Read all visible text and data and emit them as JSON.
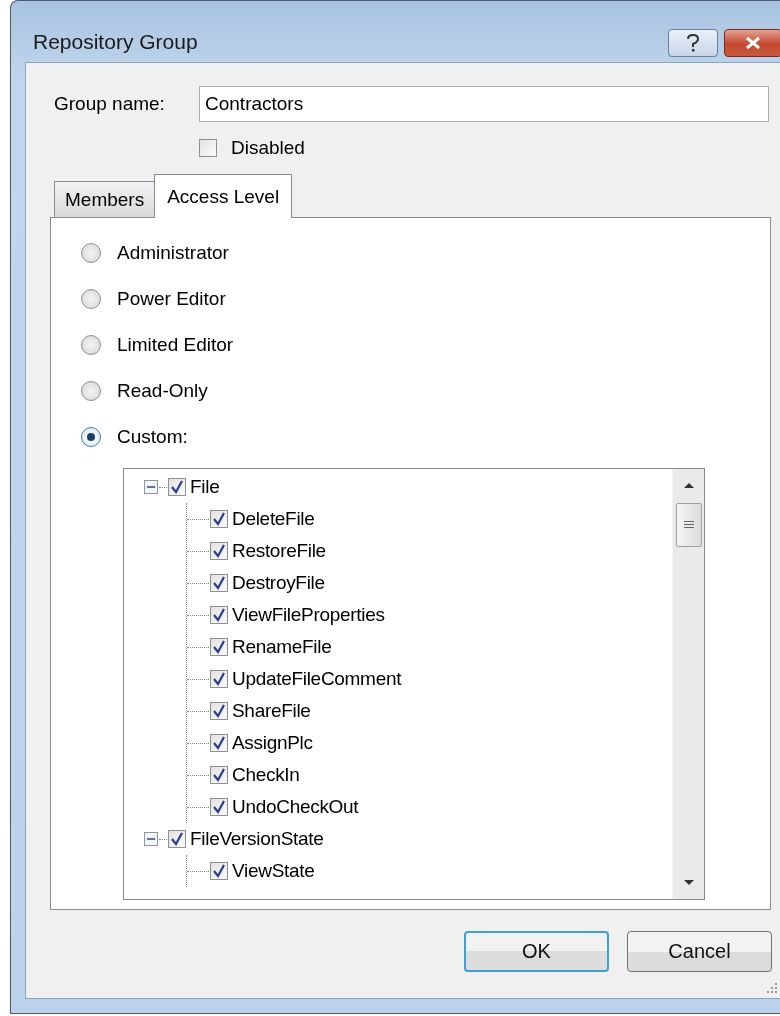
{
  "window": {
    "title": "Repository Group"
  },
  "group_name": {
    "label": "Group name:",
    "value": "Contractors"
  },
  "disabled": {
    "label": "Disabled",
    "checked": false
  },
  "tabs": [
    {
      "label": "Members",
      "selected": false
    },
    {
      "label": "Access Level",
      "selected": true
    }
  ],
  "access_levels": [
    {
      "label": "Administrator",
      "selected": false
    },
    {
      "label": "Power Editor",
      "selected": false
    },
    {
      "label": "Limited Editor",
      "selected": false
    },
    {
      "label": "Read-Only",
      "selected": false
    },
    {
      "label": "Custom:",
      "selected": true
    }
  ],
  "permissions_tree": [
    {
      "label": "File",
      "checked": true,
      "expanded": true,
      "children": [
        {
          "label": "DeleteFile",
          "checked": true
        },
        {
          "label": "RestoreFile",
          "checked": true
        },
        {
          "label": "DestroyFile",
          "checked": true
        },
        {
          "label": "ViewFileProperties",
          "checked": true
        },
        {
          "label": "RenameFile",
          "checked": true
        },
        {
          "label": "UpdateFileComment",
          "checked": true
        },
        {
          "label": "ShareFile",
          "checked": true
        },
        {
          "label": "AssignPlc",
          "checked": true
        },
        {
          "label": "CheckIn",
          "checked": true
        },
        {
          "label": "UndoCheckOut",
          "checked": true
        }
      ]
    },
    {
      "label": "FileVersionState",
      "checked": true,
      "expanded": true,
      "children": [
        {
          "label": "ViewState",
          "checked": true
        }
      ]
    }
  ],
  "buttons": [
    {
      "label": "OK",
      "kind": "default"
    },
    {
      "label": "Cancel",
      "kind": "normal"
    }
  ]
}
